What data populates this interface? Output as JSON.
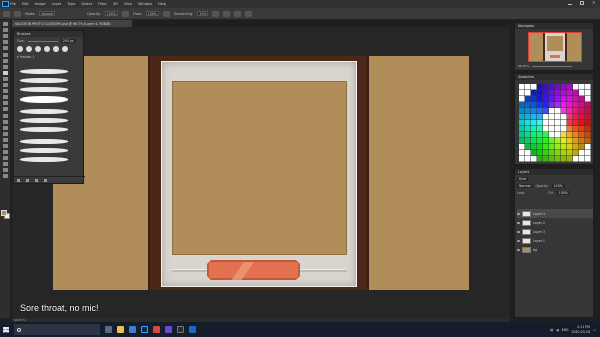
{
  "menubar": {
    "app_icon": "photoshop-logo",
    "items": [
      "File",
      "Edit",
      "Image",
      "Layer",
      "Type",
      "Select",
      "Filter",
      "3D",
      "View",
      "Window",
      "Help"
    ]
  },
  "optionsbar": {
    "mode_label": "Mode:",
    "mode_value": "Normal",
    "opacity_label": "Opacity:",
    "opacity_value": "100%",
    "flow_label": "Flow:",
    "flow_value": "100%",
    "smoothing_label": "Smoothing:",
    "smoothing_value": "10%"
  },
  "document_tab": "VACATION PHOTO CLOSEUPS.psd @ 66.7% (Layer 4, RGB/8)",
  "brushes_panel": {
    "title": "Brushes",
    "size_label": "Size:",
    "size_value": "200 px",
    "folder": "Frames 1"
  },
  "navigator": {
    "title": "Navigator",
    "zoom": "66.67%"
  },
  "swatches": {
    "title": "Swatches"
  },
  "layers_panel": {
    "title": "Layers",
    "kind_label": "Kind",
    "blend_mode": "Normal",
    "opacity_label": "Opacity:",
    "opacity_value": "100%",
    "lock_label": "Lock:",
    "fill_label": "Fill:",
    "fill_value": "100%",
    "layers": [
      {
        "name": "Layer 4",
        "selected": true,
        "visible": true
      },
      {
        "name": "Layer 2",
        "selected": false,
        "visible": true
      },
      {
        "name": "Layer 3",
        "selected": false,
        "visible": true
      },
      {
        "name": "Layer 1",
        "selected": false,
        "visible": true
      },
      {
        "name": "bg",
        "selected": false,
        "visible": true
      }
    ]
  },
  "statusbar": "66.67%",
  "subtitle": "Sore throat, no mic!",
  "taskbar": {
    "clock_time": "2:11 PM",
    "clock_date": "2020-03-18",
    "lang": "ENG"
  },
  "colors": {
    "accent": "#31a8ff",
    "canvas_tan": "#b08d59",
    "frame_brown": "#4b2718",
    "plaque_orange": "#e2714f"
  }
}
